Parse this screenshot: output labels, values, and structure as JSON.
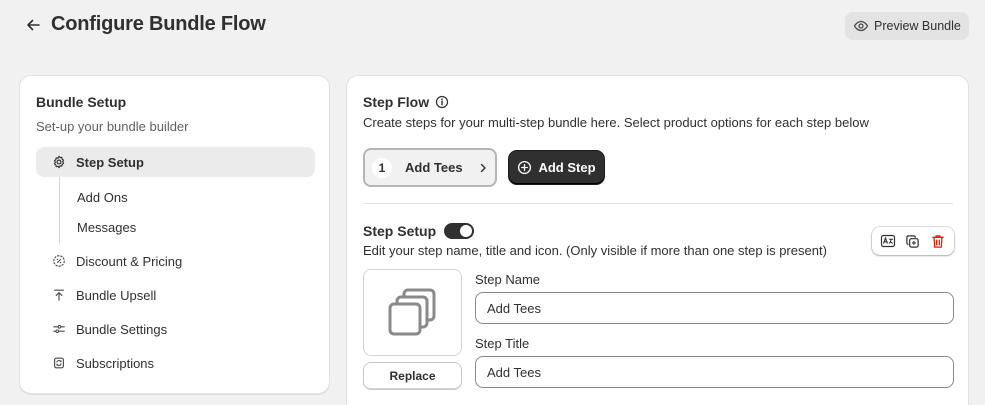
{
  "header": {
    "title": "Configure Bundle Flow",
    "preview_label": "Preview Bundle"
  },
  "sidebar": {
    "title": "Bundle Setup",
    "subtitle": "Set-up your bundle builder",
    "items": [
      {
        "label": "Step Setup",
        "icon": "gear-icon",
        "active": true
      },
      {
        "label": "Discount & Pricing",
        "icon": "discount-icon"
      },
      {
        "label": "Bundle Upsell",
        "icon": "upload-icon"
      },
      {
        "label": "Bundle Settings",
        "icon": "sliders-icon"
      },
      {
        "label": "Subscriptions",
        "icon": "subscription-icon"
      }
    ],
    "sub_items": [
      {
        "label": "Add Ons"
      },
      {
        "label": "Messages"
      }
    ]
  },
  "step_flow": {
    "title": "Step Flow",
    "description": "Create steps for your multi-step bundle here. Select product options for each step below",
    "steps": [
      {
        "number": "1",
        "label": "Add Tees"
      }
    ],
    "add_step_label": "Add Step"
  },
  "step_setup": {
    "title": "Step Setup",
    "toggle_on": true,
    "description": "Edit your step name, title and icon. (Only visible if more than one step is present)",
    "replace_label": "Replace",
    "step_name_label": "Step Name",
    "step_name_value": "Add Tees",
    "step_title_label": "Step Title",
    "step_title_value": "Add Tees"
  },
  "colors": {
    "primary_dark": "#303030",
    "background": "#f1f1f1",
    "delete_red": "#e51c00"
  }
}
